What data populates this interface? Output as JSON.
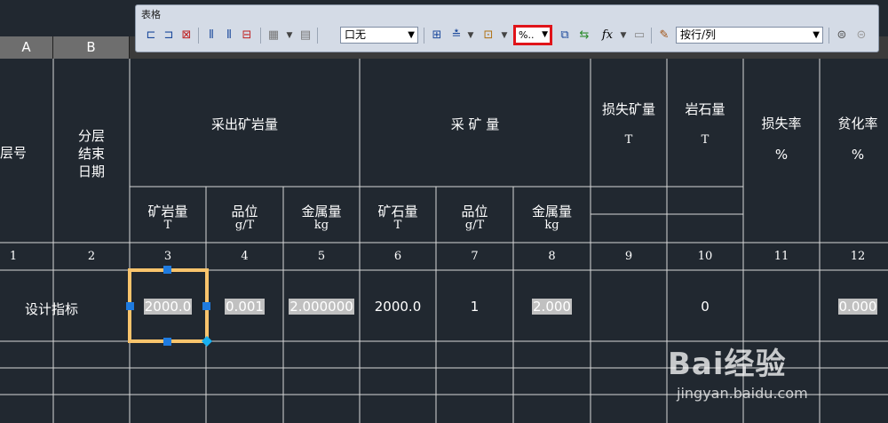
{
  "toolbar": {
    "title": "表格",
    "border_dropdown": "口无",
    "format_button": "%..",
    "fx_label": "fx",
    "rowcol_dropdown": "按行/列"
  },
  "column_headers": [
    "A",
    "B"
  ],
  "table": {
    "h_layer": "层号",
    "h_date": [
      "分层",
      "结束",
      "日期"
    ],
    "h_mined_ore": "采出矿岩量",
    "h_mining": "采 矿 量",
    "h_loss_ore": "损失矿量",
    "h_loss_ore_unit": "T",
    "h_rock": "岩石量",
    "h_rock_unit": "T",
    "h_loss_rate": "损失率",
    "h_loss_rate_unit": "%",
    "h_dilution": "贫化率",
    "h_dilution_unit": "%",
    "sub": [
      {
        "label": "矿岩量",
        "unit": "T"
      },
      {
        "label": "品位",
        "unit": "g/T"
      },
      {
        "label": "金属量",
        "unit": "kg"
      },
      {
        "label": "矿石量",
        "unit": "T"
      },
      {
        "label": "品位",
        "unit": "g/T"
      },
      {
        "label": "金属量",
        "unit": "kg"
      }
    ],
    "numbers": [
      "1",
      "2",
      "3",
      "4",
      "5",
      "6",
      "7",
      "8",
      "9",
      "10",
      "11",
      "12"
    ],
    "row_label": "设计指标",
    "row_values": {
      "c3": "2000.0",
      "c4": "0.001",
      "c5": "2.000000",
      "c6": "2000.0",
      "c7": "1",
      "c8": "2.000",
      "c10": "0",
      "c12": "0.000"
    }
  },
  "watermark": {
    "brand": "Bai经验",
    "url": "jingyan.baidu.com"
  }
}
